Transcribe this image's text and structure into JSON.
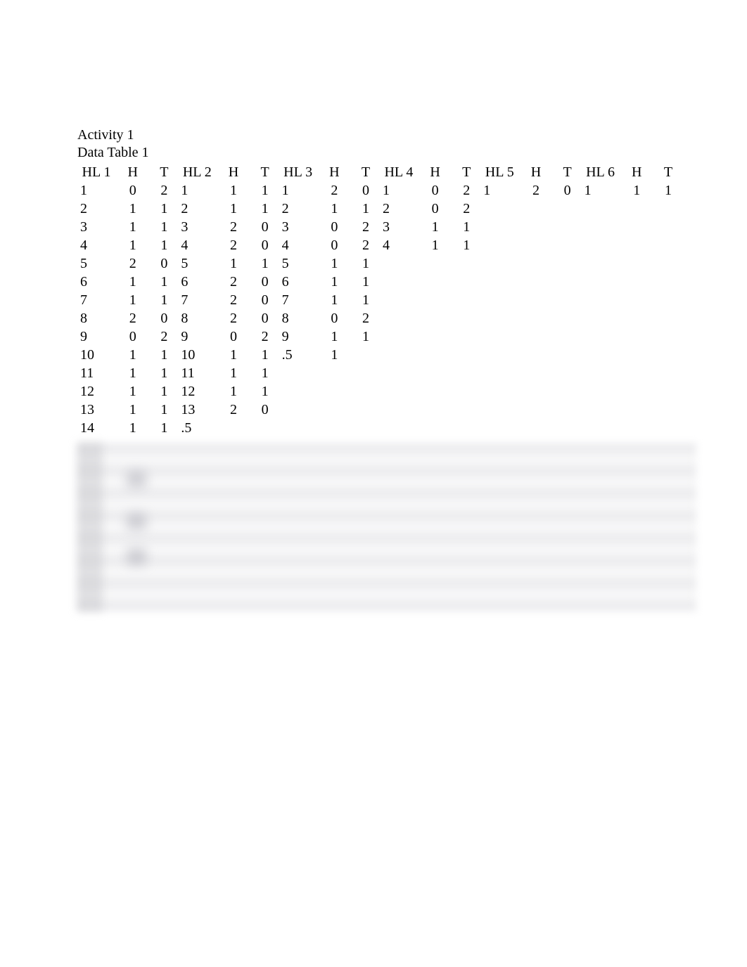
{
  "title_activity": "Activity 1",
  "title_table": "Data Table 1",
  "header_groups": [
    {
      "hl": "HL 1",
      "h": "H",
      "t": "T"
    },
    {
      "hl": "HL 2",
      "h": "H",
      "t": "T"
    },
    {
      "hl": "HL 3",
      "h": "H",
      "t": "T"
    },
    {
      "hl": "HL 4",
      "h": "H",
      "t": "T"
    },
    {
      "hl": "HL 5",
      "h": "H",
      "t": "T"
    },
    {
      "hl": "HL 6",
      "h": "H",
      "t": "T"
    }
  ],
  "rows": [
    [
      "1",
      "0",
      "2",
      "1",
      "1",
      "1",
      "1",
      "2",
      "0",
      "1",
      "0",
      "2",
      "1",
      "2",
      "0",
      "1",
      "1",
      "1"
    ],
    [
      "2",
      "1",
      "1",
      "2",
      "1",
      "1",
      "2",
      "1",
      "1",
      "2",
      "0",
      "2",
      "",
      "",
      "",
      "",
      "",
      ""
    ],
    [
      "3",
      "1",
      "1",
      "3",
      "2",
      "0",
      "3",
      "0",
      "2",
      "3",
      "1",
      "1",
      "",
      "",
      "",
      "",
      "",
      ""
    ],
    [
      "4",
      "1",
      "1",
      "4",
      "2",
      "0",
      "4",
      "0",
      "2",
      "4",
      "1",
      "1",
      "",
      "",
      "",
      "",
      "",
      ""
    ],
    [
      "5",
      "2",
      "0",
      "5",
      "1",
      "1",
      "5",
      "1",
      "1",
      "",
      "",
      "",
      "",
      "",
      "",
      "",
      "",
      ""
    ],
    [
      "6",
      "1",
      "1",
      "6",
      "2",
      "0",
      "6",
      "1",
      "1",
      "",
      "",
      "",
      "",
      "",
      "",
      "",
      "",
      ""
    ],
    [
      "7",
      "1",
      "1",
      "7",
      "2",
      "0",
      "7",
      "1",
      "1",
      "",
      "",
      "",
      "",
      "",
      "",
      "",
      "",
      ""
    ],
    [
      "8",
      "2",
      "0",
      "8",
      "2",
      "0",
      "8",
      "0",
      "2",
      "",
      "",
      "",
      "",
      "",
      "",
      "",
      "",
      ""
    ],
    [
      "9",
      "0",
      "2",
      "9",
      "0",
      "2",
      "9",
      "1",
      "1",
      "",
      "",
      "",
      "",
      "",
      "",
      "",
      "",
      ""
    ],
    [
      "10",
      "1",
      "1",
      "10",
      "1",
      "1",
      ".5",
      "1",
      "",
      "",
      "",
      "",
      "",
      "",
      "",
      "",
      "",
      ""
    ],
    [
      "11",
      "1",
      "1",
      "11",
      "1",
      "1",
      "",
      "",
      "",
      "",
      "",
      "",
      "",
      "",
      "",
      "",
      "",
      ""
    ],
    [
      "12",
      "1",
      "1",
      "12",
      "1",
      "1",
      "",
      "",
      "",
      "",
      "",
      "",
      "",
      "",
      "",
      "",
      "",
      ""
    ],
    [
      "13",
      "1",
      "1",
      "13",
      "2",
      "0",
      "",
      "",
      "",
      "",
      "",
      "",
      "",
      "",
      "",
      "",
      "",
      ""
    ],
    [
      "14",
      "1",
      "1",
      ".5",
      "",
      "",
      "",
      "",
      "",
      "",
      "",
      "",
      "",
      "",
      "",
      "",
      "",
      ""
    ]
  ]
}
